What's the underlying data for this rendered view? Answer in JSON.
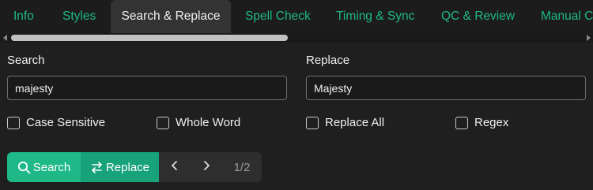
{
  "tabs": [
    {
      "label": "Info",
      "active": false
    },
    {
      "label": "Styles",
      "active": false
    },
    {
      "label": "Search & Replace",
      "active": true
    },
    {
      "label": "Spell Check",
      "active": false
    },
    {
      "label": "Timing & Sync",
      "active": false
    },
    {
      "label": "QC & Review",
      "active": false
    },
    {
      "label": "Manual C",
      "active": false
    }
  ],
  "search": {
    "label": "Search",
    "value": "majesty"
  },
  "replace": {
    "label": "Replace",
    "value": "Majesty"
  },
  "options": {
    "case_sensitive": {
      "label": "Case Sensitive",
      "checked": false
    },
    "whole_word": {
      "label": "Whole Word",
      "checked": false
    },
    "replace_all": {
      "label": "Replace All",
      "checked": false
    },
    "regex": {
      "label": "Regex",
      "checked": false
    }
  },
  "buttons": {
    "search_label": "Search",
    "replace_label": "Replace",
    "prev_icon": "chevron-left-icon",
    "next_icon": "chevron-right-icon"
  },
  "match_counter": "1/2",
  "colors": {
    "accent": "#1fb887",
    "accent_dark": "#17a27a",
    "background": "#1f1f1f",
    "active_tab": "#333333"
  }
}
